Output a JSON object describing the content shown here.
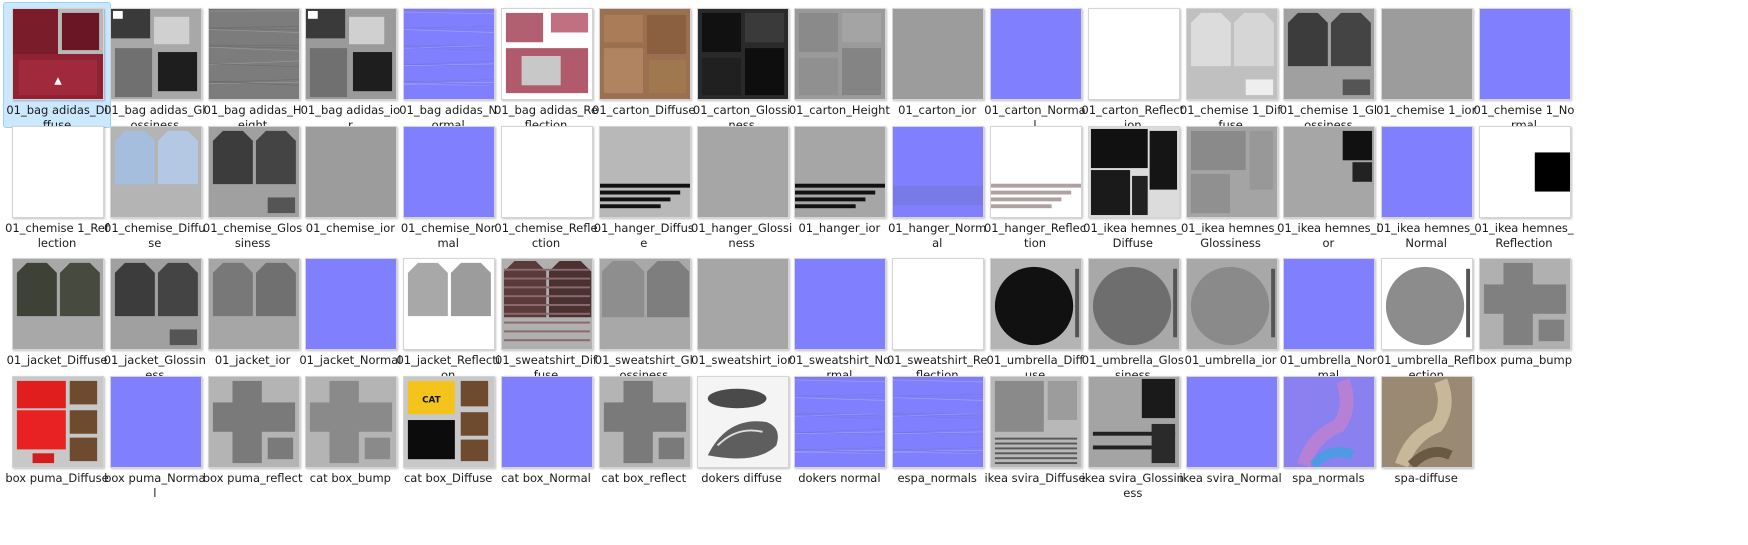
{
  "files": [
    {
      "name": "01_bag adidas_Diffuse",
      "selected": true,
      "icon": "texture-thumbnail-icon",
      "color": "#b8b8b8",
      "style": "bag-diffuse"
    },
    {
      "name": "01_bag adidas_Glossiness",
      "icon": "texture-thumbnail-icon",
      "color": "#a8a8a8",
      "style": "patches-dark"
    },
    {
      "name": "01_bag adidas_Height",
      "icon": "texture-thumbnail-icon",
      "color": "#8c8c8c",
      "style": "marble"
    },
    {
      "name": "01_bag adidas_ior",
      "icon": "texture-thumbnail-icon",
      "color": "#9a9a9a",
      "style": "patches-dark"
    },
    {
      "name": "01_bag adidas_Normal",
      "icon": "texture-thumbnail-icon",
      "color": "#8080ff",
      "style": "normal-detail"
    },
    {
      "name": "01_bag adidas_Reflection",
      "icon": "texture-thumbnail-icon",
      "color": "#ffffff",
      "style": "bag-reflection"
    },
    {
      "name": "01_carton_Diffuse",
      "icon": "texture-thumbnail-icon",
      "color": "#a0a0a0",
      "style": "carton-diffuse"
    },
    {
      "name": "01_carton_Glossiness",
      "icon": "texture-thumbnail-icon",
      "color": "#2a2a2a",
      "style": "carton-dark"
    },
    {
      "name": "01_carton_Height",
      "icon": "texture-thumbnail-icon",
      "color": "#9a9a9a",
      "style": "carton-gray"
    },
    {
      "name": "01_carton_ior",
      "icon": "texture-thumbnail-icon",
      "color": "#9c9c9c",
      "style": "plain"
    },
    {
      "name": "01_carton_Normal",
      "icon": "texture-thumbnail-icon",
      "color": "#8080ff",
      "style": "plain"
    },
    {
      "name": "01_carton_Reflection",
      "icon": "texture-thumbnail-icon",
      "color": "#ffffff",
      "style": "plain"
    },
    {
      "name": "01_chemise 1_Diffuse",
      "icon": "texture-thumbnail-icon",
      "color": "#c0c0c0",
      "style": "shirt-light"
    },
    {
      "name": "01_chemise 1_Glossiness",
      "icon": "texture-thumbnail-icon",
      "color": "#a0a0a0",
      "style": "shirt-dark"
    },
    {
      "name": "01_chemise 1_ior",
      "icon": "texture-thumbnail-icon",
      "color": "#9c9c9c",
      "style": "plain"
    },
    {
      "name": "01_chemise 1_Normal",
      "icon": "texture-thumbnail-icon",
      "color": "#8080ff",
      "style": "plain"
    },
    {
      "name": "01_chemise 1_Reflection",
      "icon": "texture-thumbnail-icon",
      "color": "#ffffff",
      "style": "plain"
    },
    {
      "name": "01_chemise_Diffuse",
      "icon": "texture-thumbnail-icon",
      "color": "#b4b4b4",
      "style": "shirt-blue"
    },
    {
      "name": "01_chemise_Glossiness",
      "icon": "texture-thumbnail-icon",
      "color": "#a0a0a0",
      "style": "shirt-dark"
    },
    {
      "name": "01_chemise_ior",
      "icon": "texture-thumbnail-icon",
      "color": "#9c9c9c",
      "style": "plain"
    },
    {
      "name": "01_chemise_Normal",
      "icon": "texture-thumbnail-icon",
      "color": "#8080ff",
      "style": "plain"
    },
    {
      "name": "01_chemise_Reflection",
      "icon": "texture-thumbnail-icon",
      "color": "#ffffff",
      "style": "plain"
    },
    {
      "name": "01_hanger_Diffuse",
      "icon": "texture-thumbnail-icon",
      "color": "#b8b8b8",
      "style": "hanger"
    },
    {
      "name": "01_hanger_Glossiness",
      "icon": "texture-thumbnail-icon",
      "color": "#a6a6a6",
      "style": "plain"
    },
    {
      "name": "01_hanger_ior",
      "icon": "texture-thumbnail-icon",
      "color": "#a6a6a6",
      "style": "hanger"
    },
    {
      "name": "01_hanger_Normal",
      "icon": "texture-thumbnail-icon",
      "color": "#8080ff",
      "style": "hanger-normal"
    },
    {
      "name": "01_hanger_Reflection",
      "icon": "texture-thumbnail-icon",
      "color": "#ffffff",
      "style": "hanger-light"
    },
    {
      "name": "01_ikea hemnes_Diffuse",
      "icon": "texture-thumbnail-icon",
      "color": "#2a2a2a",
      "style": "ikea-dark"
    },
    {
      "name": "01_ikea hemnes_Glossiness",
      "icon": "texture-thumbnail-icon",
      "color": "#a4a4a4",
      "style": "ikea-gray"
    },
    {
      "name": "01_ikea hemnes_ior",
      "icon": "texture-thumbnail-icon",
      "color": "#a6a6a6",
      "style": "ikea-ior"
    },
    {
      "name": "01_ikea hemnes_Normal",
      "icon": "texture-thumbnail-icon",
      "color": "#8080ff",
      "style": "plain"
    },
    {
      "name": "01_ikea hemnes_Reflection",
      "icon": "texture-thumbnail-icon",
      "color": "#ffffff",
      "style": "ikea-refl"
    },
    {
      "name": "01_jacket_Diffuse",
      "icon": "texture-thumbnail-icon",
      "color": "#a8a8a8",
      "style": "jacket-dark"
    },
    {
      "name": "01_jacket_Glossiness",
      "icon": "texture-thumbnail-icon",
      "color": "#a0a0a0",
      "style": "shirt-dark"
    },
    {
      "name": "01_jacket_ior",
      "icon": "texture-thumbnail-icon",
      "color": "#a6a6a6",
      "style": "shirt-mid"
    },
    {
      "name": "01_jacket_Normal",
      "icon": "texture-thumbnail-icon",
      "color": "#8080ff",
      "style": "plain"
    },
    {
      "name": "01_jacket_Reflection",
      "icon": "texture-thumbnail-icon",
      "color": "#ffffff",
      "style": "jacket-refl"
    },
    {
      "name": "01_sweatshirt_Diffuse",
      "icon": "texture-thumbnail-icon",
      "color": "#b0b0b0",
      "style": "sweat-diffuse"
    },
    {
      "name": "01_sweatshirt_Glossiness",
      "icon": "texture-thumbnail-icon",
      "color": "#a8a8a8",
      "style": "sweat-gloss"
    },
    {
      "name": "01_sweatshirt_ior",
      "icon": "texture-thumbnail-icon",
      "color": "#a6a6a6",
      "style": "plain"
    },
    {
      "name": "01_sweatshirt_Normal",
      "icon": "texture-thumbnail-icon",
      "color": "#8080ff",
      "style": "plain"
    },
    {
      "name": "01_sweatshirt_Reflection",
      "icon": "texture-thumbnail-icon",
      "color": "#ffffff",
      "style": "plain"
    },
    {
      "name": "01_umbrella_Diffuse",
      "icon": "texture-thumbnail-icon",
      "color": "#b4b4b4",
      "style": "umbrella",
      "circle": "#111111"
    },
    {
      "name": "01_umbrella_Glossiness",
      "icon": "texture-thumbnail-icon",
      "color": "#a8a8a8",
      "style": "umbrella",
      "circle": "#6e6e6e"
    },
    {
      "name": "01_umbrella_ior",
      "icon": "texture-thumbnail-icon",
      "color": "#a8a8a8",
      "style": "umbrella",
      "circle": "#8a8a8a"
    },
    {
      "name": "01_umbrella_Normal",
      "icon": "texture-thumbnail-icon",
      "color": "#8080ff",
      "style": "plain"
    },
    {
      "name": "01_umbrella_Reflection",
      "icon": "texture-thumbnail-icon",
      "color": "#ffffff",
      "style": "umbrella",
      "circle": "#8c8c8c"
    },
    {
      "name": "box puma_bump",
      "icon": "texture-thumbnail-icon",
      "color": "#b0b0b0",
      "style": "box-cross",
      "shape": "#808080"
    },
    {
      "name": "box puma_Diffuse",
      "icon": "texture-thumbnail-icon",
      "color": "#c8c8c8",
      "style": "puma-diffuse"
    },
    {
      "name": "box puma_Normal",
      "icon": "texture-thumbnail-icon",
      "color": "#8080ff",
      "style": "plain"
    },
    {
      "name": "box puma_reflect",
      "icon": "texture-thumbnail-icon",
      "color": "#b4b4b4",
      "style": "box-cross",
      "shape": "#7a7a7a"
    },
    {
      "name": "cat box_bump",
      "icon": "texture-thumbnail-icon",
      "color": "#b4b4b4",
      "style": "box-cross",
      "shape": "#8a8a8a"
    },
    {
      "name": "cat box_Diffuse",
      "icon": "texture-thumbnail-icon",
      "color": "#c8c8c8",
      "style": "cat-diffuse"
    },
    {
      "name": "cat box_Normal",
      "icon": "texture-thumbnail-icon",
      "color": "#8080ff",
      "style": "plain"
    },
    {
      "name": "cat box_reflect",
      "icon": "texture-thumbnail-icon",
      "color": "#b4b4b4",
      "style": "box-cross",
      "shape": "#7a7a7a"
    },
    {
      "name": "dokers diffuse",
      "icon": "texture-thumbnail-icon",
      "color": "#f4f4f4",
      "style": "shoes"
    },
    {
      "name": "dokers normal",
      "icon": "texture-thumbnail-icon",
      "color": "#8080ff",
      "style": "normal-detail"
    },
    {
      "name": "espa_normals",
      "icon": "texture-thumbnail-icon",
      "color": "#8080ff",
      "style": "normal-detail"
    },
    {
      "name": "ikea svira_Diffuse",
      "icon": "texture-thumbnail-icon",
      "color": "#b8b8b8",
      "style": "svira-diffuse"
    },
    {
      "name": "ikea svira_Glossiness",
      "icon": "texture-thumbnail-icon",
      "color": "#a4a4a4",
      "style": "svira-gloss"
    },
    {
      "name": "ikea svira_Normal",
      "icon": "texture-thumbnail-icon",
      "color": "#8080ff",
      "style": "plain"
    },
    {
      "name": "spa_normals",
      "icon": "texture-thumbnail-icon",
      "color": "#8a80f0",
      "style": "spa-normals"
    },
    {
      "name": "spa-diffuse",
      "icon": "texture-thumbnail-icon",
      "color": "#9a8a74",
      "style": "spa-diffuse"
    }
  ]
}
